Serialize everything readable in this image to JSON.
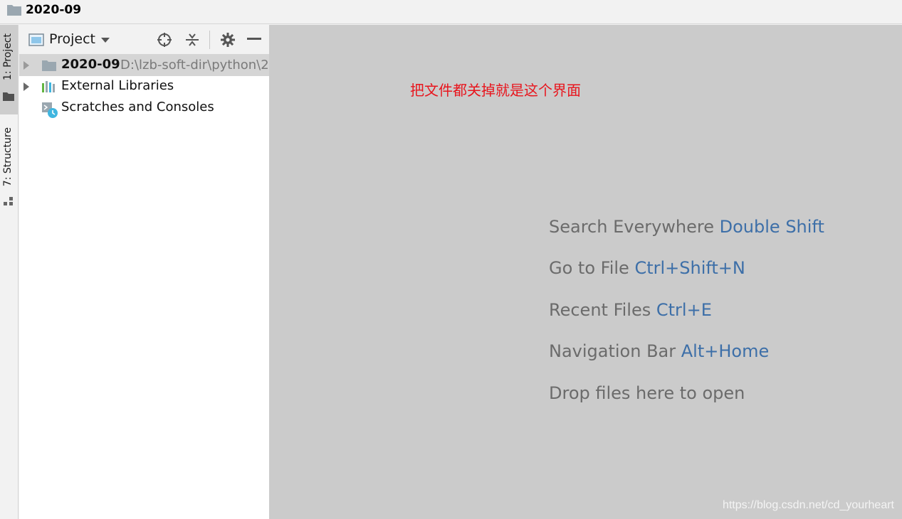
{
  "window": {
    "title": "2020-09"
  },
  "tool_strip": {
    "tabs": [
      {
        "label": "1: Project",
        "active": true
      },
      {
        "label": "7: Structure",
        "active": false
      }
    ]
  },
  "project_panel": {
    "view_selector": "Project",
    "tree": [
      {
        "label": "2020-09",
        "path": "D:\\lzb-soft-dir\\python\\2",
        "icon": "folder-icon",
        "selected": true,
        "expandable": true
      },
      {
        "label": "External Libraries",
        "icon": "library-icon",
        "selected": false,
        "expandable": true
      },
      {
        "label": "Scratches and Consoles",
        "icon": "scratches-icon",
        "selected": false,
        "expandable": false
      }
    ]
  },
  "editor": {
    "annotation": "把文件都关掉就是这个界面",
    "hints": [
      {
        "text": "Search Everywhere",
        "shortcut": "Double Shift"
      },
      {
        "text": "Go to File",
        "shortcut": "Ctrl+Shift+N"
      },
      {
        "text": "Recent Files",
        "shortcut": "Ctrl+E"
      },
      {
        "text": "Navigation Bar",
        "shortcut": "Alt+Home"
      },
      {
        "text": "Drop files here to open",
        "shortcut": ""
      }
    ],
    "watermark": "https://blog.csdn.net/cd_yourheart"
  },
  "colors": {
    "editor_bg": "#cbcbcb",
    "shortcut_blue": "#3d6fa8",
    "annotation_red": "#e8151d"
  }
}
